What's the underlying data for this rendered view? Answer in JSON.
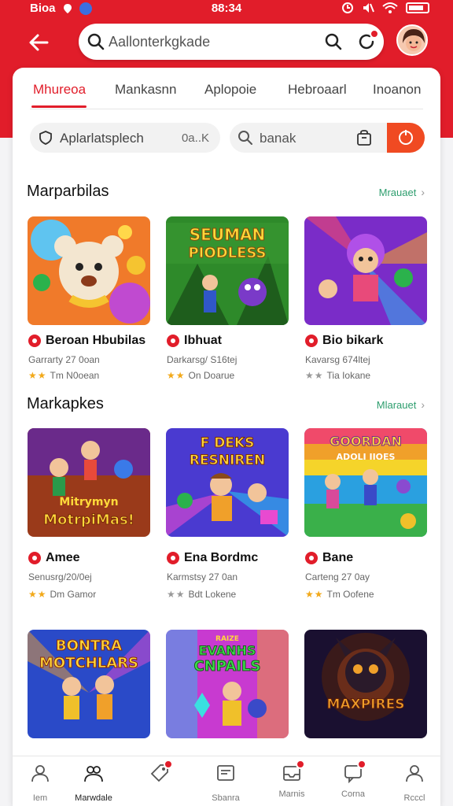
{
  "status_bar": {
    "carrier": "Bioa",
    "time": "88:34"
  },
  "search": {
    "placeholder": "Aallonterkgkade"
  },
  "tabs": [
    {
      "label": "Mhureoa",
      "active": true
    },
    {
      "label": "Mankasnn",
      "active": false
    },
    {
      "label": "Aplopoie",
      "active": false
    },
    {
      "label": "Hebroaarl",
      "active": false
    },
    {
      "label": "Inoanon",
      "active": false
    }
  ],
  "filter": {
    "label": "Aplarlatsplech",
    "value": "0a..K"
  },
  "search_pill": {
    "placeholder": "banak"
  },
  "sections": [
    {
      "title": "Marparbilas",
      "link": "Mrauaet",
      "games": [
        {
          "title": "Beroan Hbubilas",
          "subtitle": "Garrarty 27 0oan",
          "stars": "★★",
          "rating": "Tm N0oean",
          "star_color": "gold",
          "art": "bear"
        },
        {
          "title": "Ibhuat",
          "subtitle": "Darkarsg/ S16tej",
          "stars": "★★",
          "rating": "On Doarue",
          "star_color": "gold",
          "art": "jungle"
        },
        {
          "title": "Bio bikark",
          "subtitle": "Kavarsg 674ltej",
          "stars": "★★",
          "rating": "Tia Iokane",
          "star_color": "grey",
          "art": "purple"
        }
      ]
    },
    {
      "title": "Markapkes",
      "link": "Mlarauet",
      "games": [
        {
          "title": "Amee",
          "subtitle": "Senusrg/20/0ej",
          "stars": "★★",
          "rating": "Dm Gamor",
          "star_color": "gold",
          "art": "heroes"
        },
        {
          "title": "Ena Bordmc",
          "subtitle": "Karmstsy 27 0an",
          "stars": "★★",
          "rating": "Bdt Lokene",
          "star_color": "grey",
          "art": "blaster"
        },
        {
          "title": "Bane",
          "subtitle": "Carteng 27 0ay",
          "stars": "★★",
          "rating": "Tm Oofene",
          "star_color": "gold",
          "art": "rainbow"
        }
      ]
    },
    {
      "title": "",
      "link": "",
      "games": [
        {
          "title": "",
          "subtitle": "",
          "stars": "",
          "rating": "",
          "star_color": "gold",
          "art": "brothers"
        },
        {
          "title": "",
          "subtitle": "",
          "stars": "",
          "rating": "",
          "star_color": "gold",
          "art": "crystals"
        },
        {
          "title": "",
          "subtitle": "",
          "stars": "",
          "rating": "",
          "star_color": "gold",
          "art": "monster"
        }
      ]
    }
  ],
  "thumb_text": {
    "jungle": [
      "SEUMAN",
      "PIODLESS"
    ],
    "heroes": [
      "Mitrymyn",
      "MotrpiMas!"
    ],
    "blaster": [
      "F DEKS",
      "RESNIREN"
    ],
    "rainbow": [
      "GOORDAN",
      "ADOLI IIOES"
    ],
    "brothers": [
      "BONTRA",
      "MOTCHLARS"
    ],
    "crystals": [
      "RAIZE",
      "EVANHS",
      "CNPAILS"
    ],
    "monster": [
      "MAXPIRES"
    ]
  },
  "bottom_nav": [
    {
      "label": "Iem",
      "icon": "person-icon",
      "active": false,
      "dot": false
    },
    {
      "label": "Marwdale",
      "icon": "people-icon",
      "active": true,
      "dot": false
    },
    {
      "label": "",
      "icon": "shopping-tag-icon",
      "active": false,
      "dot": true
    },
    {
      "label": "Sbanra",
      "icon": "store-icon",
      "active": false,
      "dot": false
    },
    {
      "label": "Marnis",
      "icon": "inbox-icon",
      "active": false,
      "dot": true
    },
    {
      "label": "Corna",
      "icon": "chat-icon",
      "active": false,
      "dot": true
    },
    {
      "label": "Rcccl",
      "icon": "profile-icon",
      "active": false,
      "dot": false
    }
  ],
  "colors": {
    "brand": "#e11d2a",
    "accent": "#f04a22",
    "link": "#2e9e6e",
    "star": "#f2a91a"
  }
}
